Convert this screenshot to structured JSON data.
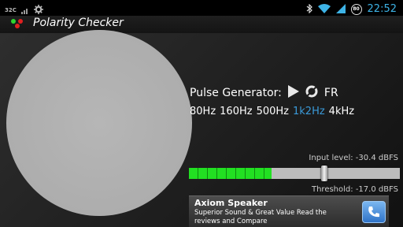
{
  "status_bar": {
    "left_badge": "32C",
    "icons": [
      "signal-bars-icon",
      "gear-icon"
    ],
    "right_icons": [
      "bluetooth-icon",
      "wifi-icon",
      "cell-signal-icon",
      "battery-icon"
    ],
    "battery_level": "80",
    "clock": "22:52"
  },
  "action_bar": {
    "title": "Polarity Checker",
    "icon": "polarity-app-icon"
  },
  "pulse_generator": {
    "label": "Pulse Generator:",
    "play_icon": "play-icon",
    "polarity_icon": "polarity-cycle-icon",
    "mode": "FR"
  },
  "frequencies": {
    "items": [
      "80Hz",
      "160Hz",
      "500Hz",
      "1k2Hz",
      "4kHz"
    ],
    "selected_index": 3,
    "selected_color": "#3a9ad9"
  },
  "meter": {
    "input_level_label": "Input level: -30.4 dBFS",
    "threshold_label": "Threshold: -17.0 dBFS",
    "level_fraction": 0.39,
    "threshold_fraction": 0.64,
    "fill_color": "#22e022"
  },
  "ad": {
    "title": "Axiom Speaker",
    "body": "Superior Sound & Great Value Read the reviews and Compare",
    "button_icon": "phone-icon"
  }
}
